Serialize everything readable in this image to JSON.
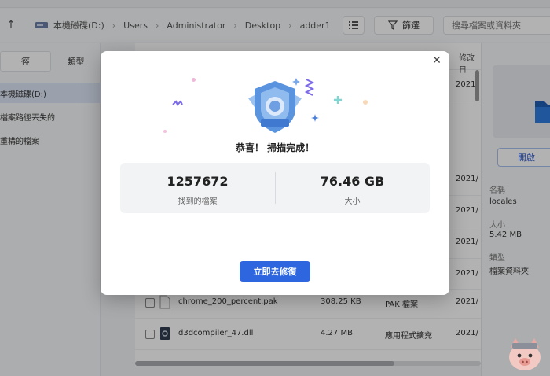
{
  "top": {
    "tab_label": "…"
  },
  "address_bar": {
    "up_icon": "up-arrow-icon",
    "crumbs": [
      "本機磁碟(D:)",
      "Users",
      "Administrator",
      "Desktop",
      "adder1"
    ],
    "filter_label": "篩選",
    "search_placeholder": "搜尋檔案或資料夾"
  },
  "sidebar": {
    "tabs": [
      "徑",
      "類型"
    ],
    "items": [
      "本機磁碟(D:)",
      "檔案路徑丟失的",
      "重構的檔案"
    ]
  },
  "table": {
    "columns": {
      "modified": "修改日"
    },
    "rows": [
      {
        "date": "2021/"
      },
      {
        "date": "2021/"
      },
      {
        "date": "2021/"
      },
      {
        "date": "2021/"
      },
      {
        "date": "2021/"
      },
      {
        "name": "chrome_200_percent.pak",
        "size": "308.25 KB",
        "type": "PAK 檔案",
        "date": "2021/"
      },
      {
        "name": "d3dcompiler_47.dll",
        "size": "4.27 MB",
        "type": "應用程式擴充",
        "date": "2021/"
      }
    ]
  },
  "details": {
    "open_label": "開啟",
    "fields": [
      {
        "label": "名稱",
        "value": "locales"
      },
      {
        "label": "大小",
        "value": "5.42 MB"
      },
      {
        "label": "類型",
        "value": "檔案資料夾"
      }
    ]
  },
  "modal": {
    "title": "恭喜！ 掃描完成！",
    "stats": [
      {
        "value": "1257672",
        "label": "找到的檔案"
      },
      {
        "value": "76.46 GB",
        "label": "大小"
      }
    ],
    "button_label": "立即去修復",
    "colors": {
      "accent": "#2e66e0"
    }
  }
}
